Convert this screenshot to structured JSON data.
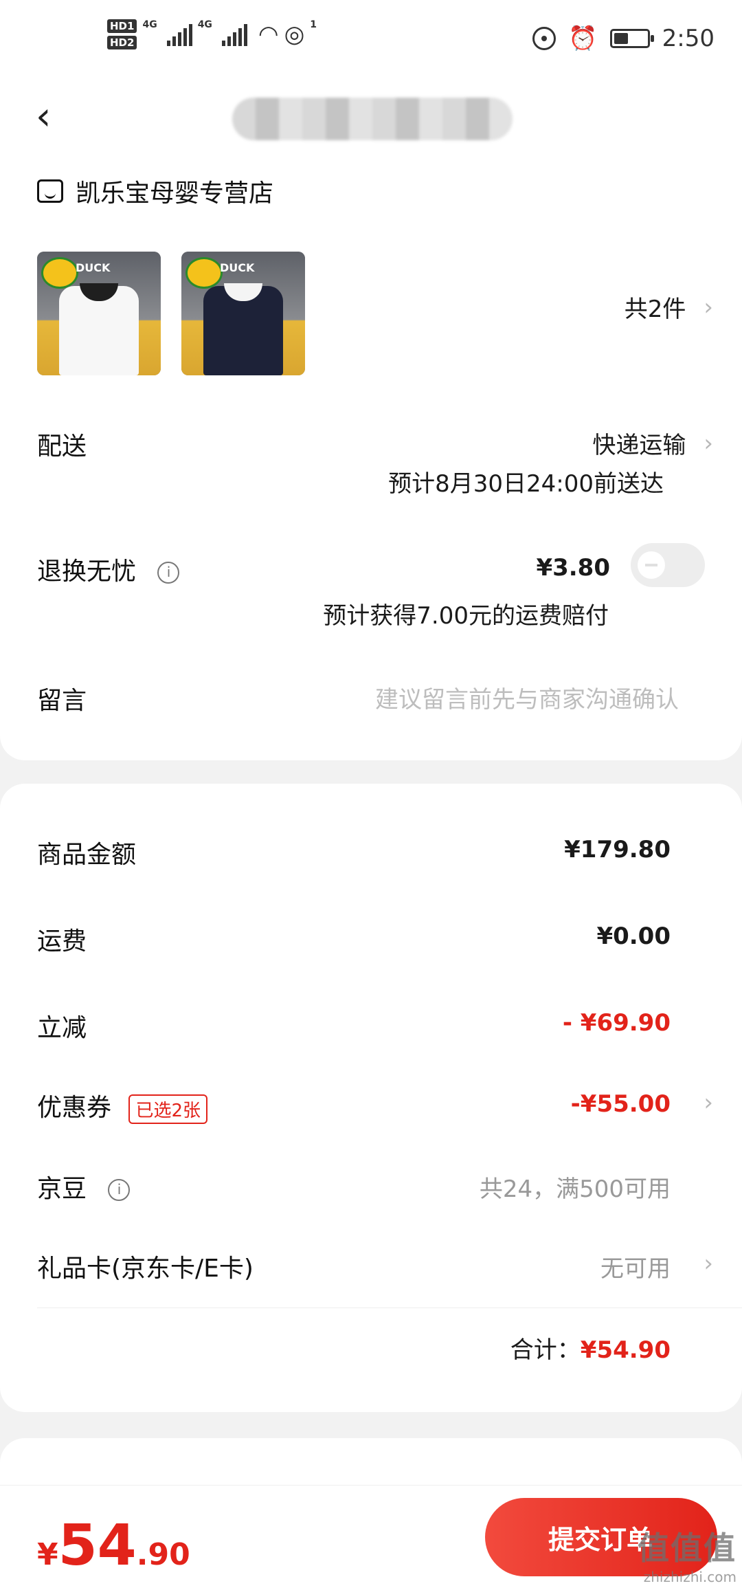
{
  "status_bar": {
    "sim1": "HD1",
    "sim2": "HD2",
    "net1": "4G",
    "net2": "4G",
    "wifi_badge": "1",
    "time": "2:50"
  },
  "header": {
    "back_icon": "chevron-left-icon"
  },
  "store": {
    "name": "凯乐宝母婴专营店"
  },
  "products": {
    "brand": "DUCK",
    "count_label": "共2件"
  },
  "delivery": {
    "label": "配送",
    "method": "快递运输",
    "eta": "预计8月30日24:00前送达"
  },
  "return_insurance": {
    "label": "退换无忧",
    "price": "¥3.80",
    "note": "预计获得7.00元的运费赔付",
    "enabled": false
  },
  "message": {
    "label": "留言",
    "placeholder": "建议留言前先与商家沟通确认"
  },
  "summary": {
    "goods_label": "商品金额",
    "goods_value": "¥179.80",
    "shipping_label": "运费",
    "shipping_value": "¥0.00",
    "discount_label": "立减",
    "discount_value": "- ¥69.90",
    "coupon_label": "优惠券",
    "coupon_tag": "已选2张",
    "coupon_value": "-¥55.00",
    "beans_label": "京豆",
    "beans_value": "共24，满500可用",
    "giftcard_label": "礼品卡(京东卡/E卡)",
    "giftcard_value": "无可用",
    "total_label": "合计：",
    "total_value": "¥54.90"
  },
  "bottom": {
    "currency": "¥",
    "price_int": "54",
    "price_dec": ".90",
    "submit_label": "提交订单"
  },
  "watermark": {
    "mark": "值值值",
    "site": "zhizhizhi.com"
  },
  "colors": {
    "accent_red": "#e2231a",
    "background": "#f2f2f2"
  }
}
